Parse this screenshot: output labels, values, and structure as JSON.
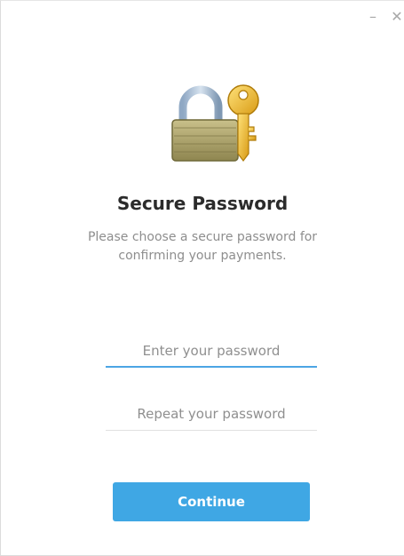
{
  "window": {
    "minimize_glyph": "–",
    "close_glyph": "✕"
  },
  "header": {
    "icon": "lock-with-key-icon",
    "title": "Secure Password",
    "description": "Please choose a secure password for confirming your payments."
  },
  "form": {
    "password_placeholder": "Enter your password",
    "password_value": "",
    "repeat_placeholder": "Repeat your password",
    "repeat_value": ""
  },
  "actions": {
    "continue_label": "Continue"
  },
  "colors": {
    "accent": "#3fa7e4",
    "focus_underline": "#4ca5e4",
    "title_text": "#2b2b2b",
    "muted_text": "#8e8e8e"
  }
}
